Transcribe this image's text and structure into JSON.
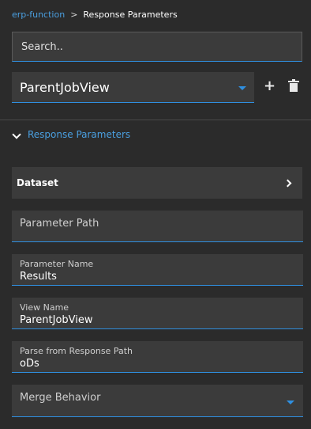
{
  "breadcrumb": {
    "parent": "erp-function",
    "separator": ">",
    "current": "Response Parameters"
  },
  "search": {
    "placeholder": "Search.."
  },
  "view_select": {
    "value": "ParentJobView"
  },
  "actions": {
    "add": "+",
    "delete": "delete"
  },
  "section": {
    "title": "Response Parameters"
  },
  "dataset": {
    "label": "Dataset"
  },
  "fields": {
    "parameter_path": {
      "label": "Parameter Path",
      "value": ""
    },
    "parameter_name": {
      "label": "Parameter Name",
      "value": "Results"
    },
    "view_name": {
      "label": "View Name",
      "value": "ParentJobView"
    },
    "parse_path": {
      "label": "Parse from Response Path",
      "value": "oDs"
    },
    "merge_behavior": {
      "label": "Merge Behavior"
    }
  },
  "colors": {
    "accent": "#2f8fe0",
    "link": "#4a9fe0",
    "background": "#2b2b2b",
    "field_bg": "#3b3b3b"
  },
  "icons": {
    "add": "plus-icon",
    "delete": "trash-icon",
    "collapse": "chevron-down-icon",
    "open": "chevron-right-icon",
    "dropdown": "caret-down-icon"
  }
}
